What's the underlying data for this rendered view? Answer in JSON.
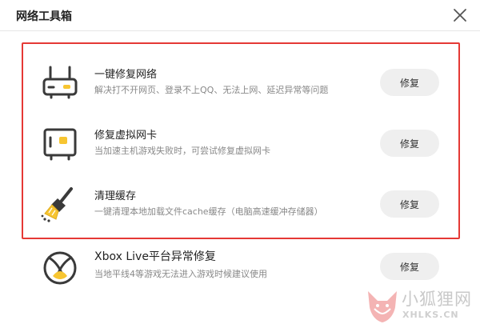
{
  "window": {
    "title": "网络工具箱"
  },
  "tools": [
    {
      "name": "一键修复网络",
      "description": "解决打不开网页、登录不上QQ、无法上网、延迟异常等问题",
      "button_label": "修复",
      "icon": "router-icon"
    },
    {
      "name": "修复虚拟网卡",
      "description": "当加速主机游戏失败时，可尝试修复虚拟网卡",
      "button_label": "修复",
      "icon": "network-card-icon"
    },
    {
      "name": "清理缓存",
      "description": "一键清理本地加载文件cache缓存（电脑高速缓冲存储器）",
      "button_label": "修复",
      "icon": "broom-icon"
    },
    {
      "name": "Xbox Live平台异常修复",
      "description": "当地平线4等游戏无法进入游戏时候建议使用",
      "button_label": "修复",
      "icon": "xbox-icon"
    }
  ],
  "watermark": {
    "cn": "小狐狸网",
    "en": "XHLKS.CN"
  },
  "colors": {
    "accent": "#f7c531",
    "icon_stroke": "#3a3a3a",
    "highlight": "#e53935",
    "button_bg": "#efefef"
  }
}
